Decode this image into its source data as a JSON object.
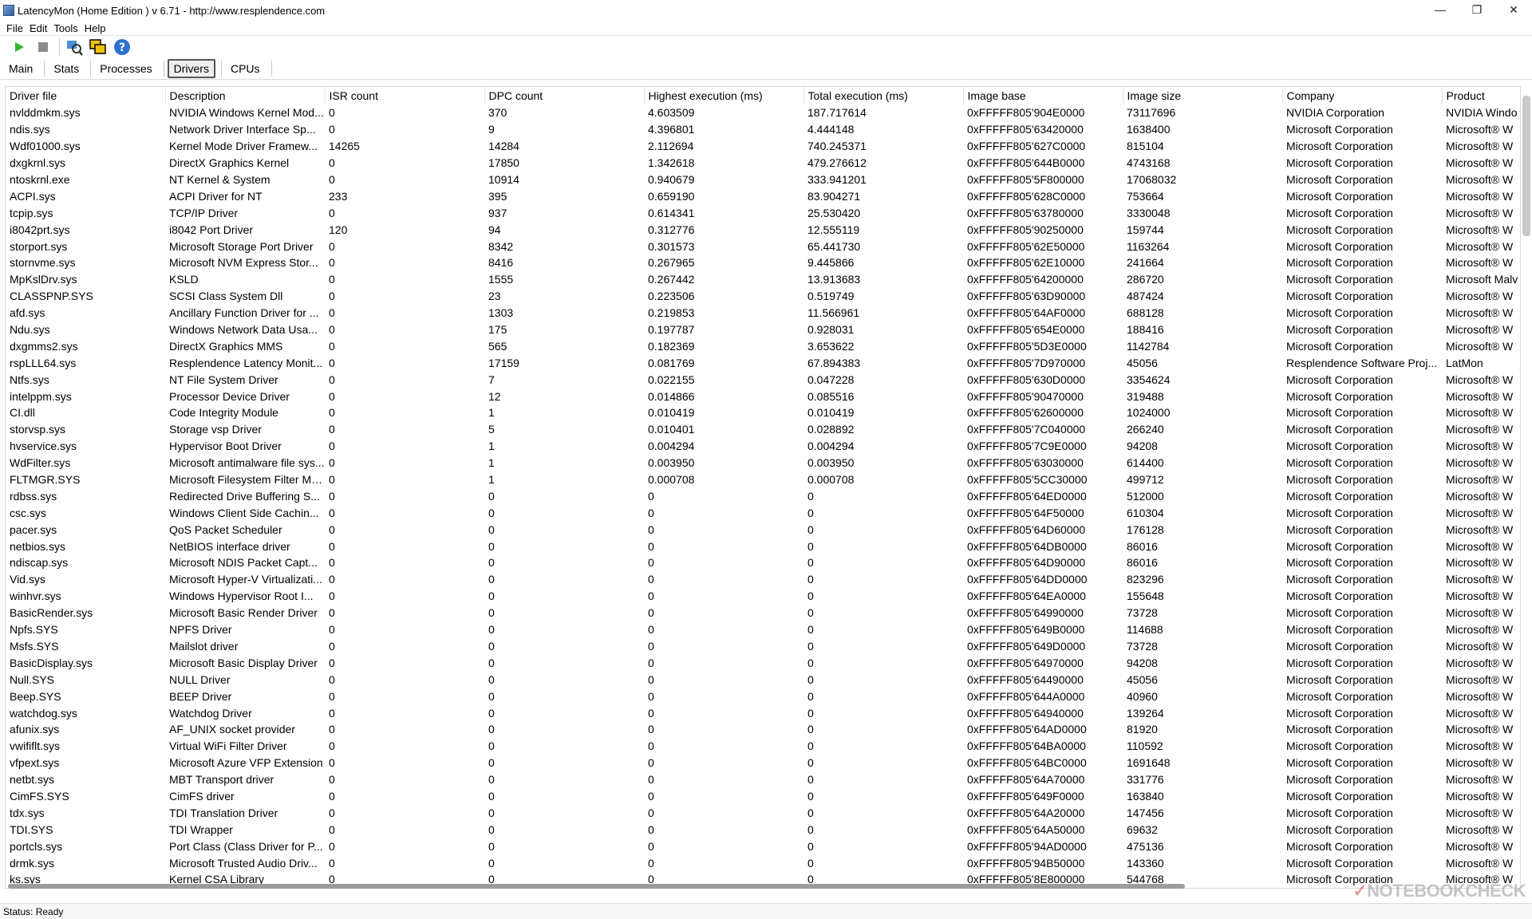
{
  "window": {
    "title": "LatencyMon  (Home Edition )  v 6.71 - http://www.resplendence.com"
  },
  "menu": [
    "File",
    "Edit",
    "Tools",
    "Help"
  ],
  "toolbar": {
    "icons": [
      "play-icon",
      "stop-icon",
      "search-driver-icon",
      "windows-icon",
      "help-icon"
    ]
  },
  "tabs": [
    {
      "label": "Main",
      "active": false
    },
    {
      "label": "Stats",
      "active": false
    },
    {
      "label": "Processes",
      "active": false
    },
    {
      "label": "Drivers",
      "active": true
    },
    {
      "label": "CPUs",
      "active": false
    }
  ],
  "table": {
    "columns": [
      "Driver file",
      "Description",
      "ISR count",
      "DPC count",
      "Highest execution (ms)",
      "Total execution (ms)",
      "Image base",
      "Image size",
      "Company",
      "Product"
    ],
    "rows": [
      [
        "nvlddmkm.sys",
        "NVIDIA Windows Kernel Mod...",
        "0",
        "370",
        "4.603509",
        "187.717614",
        "0xFFFFF805'904E0000",
        "73117696",
        "NVIDIA Corporation",
        "NVIDIA Windo"
      ],
      [
        "ndis.sys",
        "Network Driver Interface Sp...",
        "0",
        "9",
        "4.396801",
        "4.444148",
        "0xFFFFF805'63420000",
        "1638400",
        "Microsoft Corporation",
        "Microsoft® W"
      ],
      [
        "Wdf01000.sys",
        "Kernel Mode Driver Framew...",
        "14265",
        "14284",
        "2.112694",
        "740.245371",
        "0xFFFFF805'627C0000",
        "815104",
        "Microsoft Corporation",
        "Microsoft® W"
      ],
      [
        "dxgkrnl.sys",
        "DirectX Graphics Kernel",
        "0",
        "17850",
        "1.342618",
        "479.276612",
        "0xFFFFF805'644B0000",
        "4743168",
        "Microsoft Corporation",
        "Microsoft® W"
      ],
      [
        "ntoskrnl.exe",
        "NT Kernel & System",
        "0",
        "10914",
        "0.940679",
        "333.941201",
        "0xFFFFF805'5F800000",
        "17068032",
        "Microsoft Corporation",
        "Microsoft® W"
      ],
      [
        "ACPI.sys",
        "ACPI Driver for NT",
        "233",
        "395",
        "0.659190",
        "83.904271",
        "0xFFFFF805'628C0000",
        "753664",
        "Microsoft Corporation",
        "Microsoft® W"
      ],
      [
        "tcpip.sys",
        "TCP/IP Driver",
        "0",
        "937",
        "0.614341",
        "25.530420",
        "0xFFFFF805'63780000",
        "3330048",
        "Microsoft Corporation",
        "Microsoft® W"
      ],
      [
        "i8042prt.sys",
        "i8042 Port Driver",
        "120",
        "94",
        "0.312776",
        "12.555119",
        "0xFFFFF805'90250000",
        "159744",
        "Microsoft Corporation",
        "Microsoft® W"
      ],
      [
        "storport.sys",
        "Microsoft Storage Port Driver",
        "0",
        "8342",
        "0.301573",
        "65.441730",
        "0xFFFFF805'62E50000",
        "1163264",
        "Microsoft Corporation",
        "Microsoft® W"
      ],
      [
        "stornvme.sys",
        "Microsoft NVM Express Stor...",
        "0",
        "8416",
        "0.267965",
        "9.445866",
        "0xFFFFF805'62E10000",
        "241664",
        "Microsoft Corporation",
        "Microsoft® W"
      ],
      [
        "MpKslDrv.sys",
        "KSLD",
        "0",
        "1555",
        "0.267442",
        "13.913683",
        "0xFFFFF805'64200000",
        "286720",
        "Microsoft Corporation",
        "Microsoft Malv"
      ],
      [
        "CLASSPNP.SYS",
        "SCSI Class System Dll",
        "0",
        "23",
        "0.223506",
        "0.519749",
        "0xFFFFF805'63D90000",
        "487424",
        "Microsoft Corporation",
        "Microsoft® W"
      ],
      [
        "afd.sys",
        "Ancillary Function Driver for ...",
        "0",
        "1303",
        "0.219853",
        "11.566961",
        "0xFFFFF805'64AF0000",
        "688128",
        "Microsoft Corporation",
        "Microsoft® W"
      ],
      [
        "Ndu.sys",
        "Windows Network Data Usa...",
        "0",
        "175",
        "0.197787",
        "0.928031",
        "0xFFFFF805'654E0000",
        "188416",
        "Microsoft Corporation",
        "Microsoft® W"
      ],
      [
        "dxgmms2.sys",
        "DirectX Graphics MMS",
        "0",
        "565",
        "0.182369",
        "3.653622",
        "0xFFFFF805'5D3E0000",
        "1142784",
        "Microsoft Corporation",
        "Microsoft® W"
      ],
      [
        "rspLLL64.sys",
        "Resplendence Latency Monit...",
        "0",
        "17159",
        "0.081769",
        "67.894383",
        "0xFFFFF805'7D970000",
        "45056",
        "Resplendence Software Proj...",
        "LatMon"
      ],
      [
        "Ntfs.sys",
        "NT File System Driver",
        "0",
        "7",
        "0.022155",
        "0.047228",
        "0xFFFFF805'630D0000",
        "3354624",
        "Microsoft Corporation",
        "Microsoft® W"
      ],
      [
        "intelppm.sys",
        "Processor Device Driver",
        "0",
        "12",
        "0.014866",
        "0.085516",
        "0xFFFFF805'90470000",
        "319488",
        "Microsoft Corporation",
        "Microsoft® W"
      ],
      [
        "CI.dll",
        "Code Integrity Module",
        "0",
        "1",
        "0.010419",
        "0.010419",
        "0xFFFFF805'62600000",
        "1024000",
        "Microsoft Corporation",
        "Microsoft® W"
      ],
      [
        "storvsp.sys",
        "Storage vsp Driver",
        "0",
        "5",
        "0.010401",
        "0.028892",
        "0xFFFFF805'7C040000",
        "266240",
        "Microsoft Corporation",
        "Microsoft® W"
      ],
      [
        "hvservice.sys",
        "Hypervisor Boot Driver",
        "0",
        "1",
        "0.004294",
        "0.004294",
        "0xFFFFF805'7C9E0000",
        "94208",
        "Microsoft Corporation",
        "Microsoft® W"
      ],
      [
        "WdFilter.sys",
        "Microsoft antimalware file sys...",
        "0",
        "1",
        "0.003950",
        "0.003950",
        "0xFFFFF805'63030000",
        "614400",
        "Microsoft Corporation",
        "Microsoft® W"
      ],
      [
        "FLTMGR.SYS",
        "Microsoft Filesystem Filter Ma...",
        "0",
        "1",
        "0.000708",
        "0.000708",
        "0xFFFFF805'5CC30000",
        "499712",
        "Microsoft Corporation",
        "Microsoft® W"
      ],
      [
        "rdbss.sys",
        "Redirected Drive Buffering S...",
        "0",
        "0",
        "0",
        "0",
        "0xFFFFF805'64ED0000",
        "512000",
        "Microsoft Corporation",
        "Microsoft® W"
      ],
      [
        "csc.sys",
        "Windows Client Side Cachin...",
        "0",
        "0",
        "0",
        "0",
        "0xFFFFF805'64F50000",
        "610304",
        "Microsoft Corporation",
        "Microsoft® W"
      ],
      [
        "pacer.sys",
        "QoS Packet Scheduler",
        "0",
        "0",
        "0",
        "0",
        "0xFFFFF805'64D60000",
        "176128",
        "Microsoft Corporation",
        "Microsoft® W"
      ],
      [
        "netbios.sys",
        "NetBIOS interface driver",
        "0",
        "0",
        "0",
        "0",
        "0xFFFFF805'64DB0000",
        "86016",
        "Microsoft Corporation",
        "Microsoft® W"
      ],
      [
        "ndiscap.sys",
        "Microsoft NDIS Packet Capt...",
        "0",
        "0",
        "0",
        "0",
        "0xFFFFF805'64D90000",
        "86016",
        "Microsoft Corporation",
        "Microsoft® W"
      ],
      [
        "Vid.sys",
        "Microsoft Hyper-V Virtualizati...",
        "0",
        "0",
        "0",
        "0",
        "0xFFFFF805'64DD0000",
        "823296",
        "Microsoft Corporation",
        "Microsoft® W"
      ],
      [
        "winhvr.sys",
        "Windows Hypervisor Root I...",
        "0",
        "0",
        "0",
        "0",
        "0xFFFFF805'64EA0000",
        "155648",
        "Microsoft Corporation",
        "Microsoft® W"
      ],
      [
        "BasicRender.sys",
        "Microsoft Basic Render Driver",
        "0",
        "0",
        "0",
        "0",
        "0xFFFFF805'64990000",
        "73728",
        "Microsoft Corporation",
        "Microsoft® W"
      ],
      [
        "Npfs.SYS",
        "NPFS Driver",
        "0",
        "0",
        "0",
        "0",
        "0xFFFFF805'649B0000",
        "114688",
        "Microsoft Corporation",
        "Microsoft® W"
      ],
      [
        "Msfs.SYS",
        "Mailslot driver",
        "0",
        "0",
        "0",
        "0",
        "0xFFFFF805'649D0000",
        "73728",
        "Microsoft Corporation",
        "Microsoft® W"
      ],
      [
        "BasicDisplay.sys",
        "Microsoft Basic Display Driver",
        "0",
        "0",
        "0",
        "0",
        "0xFFFFF805'64970000",
        "94208",
        "Microsoft Corporation",
        "Microsoft® W"
      ],
      [
        "Null.SYS",
        "NULL Driver",
        "0",
        "0",
        "0",
        "0",
        "0xFFFFF805'64490000",
        "45056",
        "Microsoft Corporation",
        "Microsoft® W"
      ],
      [
        "Beep.SYS",
        "BEEP Driver",
        "0",
        "0",
        "0",
        "0",
        "0xFFFFF805'644A0000",
        "40960",
        "Microsoft Corporation",
        "Microsoft® W"
      ],
      [
        "watchdog.sys",
        "Watchdog Driver",
        "0",
        "0",
        "0",
        "0",
        "0xFFFFF805'64940000",
        "139264",
        "Microsoft Corporation",
        "Microsoft® W"
      ],
      [
        "afunix.sys",
        "AF_UNIX socket provider",
        "0",
        "0",
        "0",
        "0",
        "0xFFFFF805'64AD0000",
        "81920",
        "Microsoft Corporation",
        "Microsoft® W"
      ],
      [
        "vwififlt.sys",
        "Virtual WiFi Filter Driver",
        "0",
        "0",
        "0",
        "0",
        "0xFFFFF805'64BA0000",
        "110592",
        "Microsoft Corporation",
        "Microsoft® W"
      ],
      [
        "vfpext.sys",
        "Microsoft Azure VFP Extension",
        "0",
        "0",
        "0",
        "0",
        "0xFFFFF805'64BC0000",
        "1691648",
        "Microsoft Corporation",
        "Microsoft® W"
      ],
      [
        "netbt.sys",
        "MBT Transport driver",
        "0",
        "0",
        "0",
        "0",
        "0xFFFFF805'64A70000",
        "331776",
        "Microsoft Corporation",
        "Microsoft® W"
      ],
      [
        "CimFS.SYS",
        "CimFS driver",
        "0",
        "0",
        "0",
        "0",
        "0xFFFFF805'649F0000",
        "163840",
        "Microsoft Corporation",
        "Microsoft® W"
      ],
      [
        "tdx.sys",
        "TDI Translation Driver",
        "0",
        "0",
        "0",
        "0",
        "0xFFFFF805'64A20000",
        "147456",
        "Microsoft Corporation",
        "Microsoft® W"
      ],
      [
        "TDI.SYS",
        "TDI Wrapper",
        "0",
        "0",
        "0",
        "0",
        "0xFFFFF805'64A50000",
        "69632",
        "Microsoft Corporation",
        "Microsoft® W"
      ],
      [
        "portcls.sys",
        "Port Class (Class Driver for P...",
        "0",
        "0",
        "0",
        "0",
        "0xFFFFF805'94AD0000",
        "475136",
        "Microsoft Corporation",
        "Microsoft® W"
      ],
      [
        "drmk.sys",
        "Microsoft Trusted Audio Driv...",
        "0",
        "0",
        "0",
        "0",
        "0xFFFFF805'94B50000",
        "143360",
        "Microsoft Corporation",
        "Microsoft® W"
      ],
      [
        "ks.sys",
        "Kernel CSA Library",
        "0",
        "0",
        "0",
        "0",
        "0xFFFFF805'8E800000",
        "544768",
        "Microsoft Corporation",
        "Microsoft® W"
      ]
    ]
  },
  "status": {
    "text": "Status: Ready"
  },
  "watermark": {
    "text": "NOTEBOOKCHECK"
  }
}
